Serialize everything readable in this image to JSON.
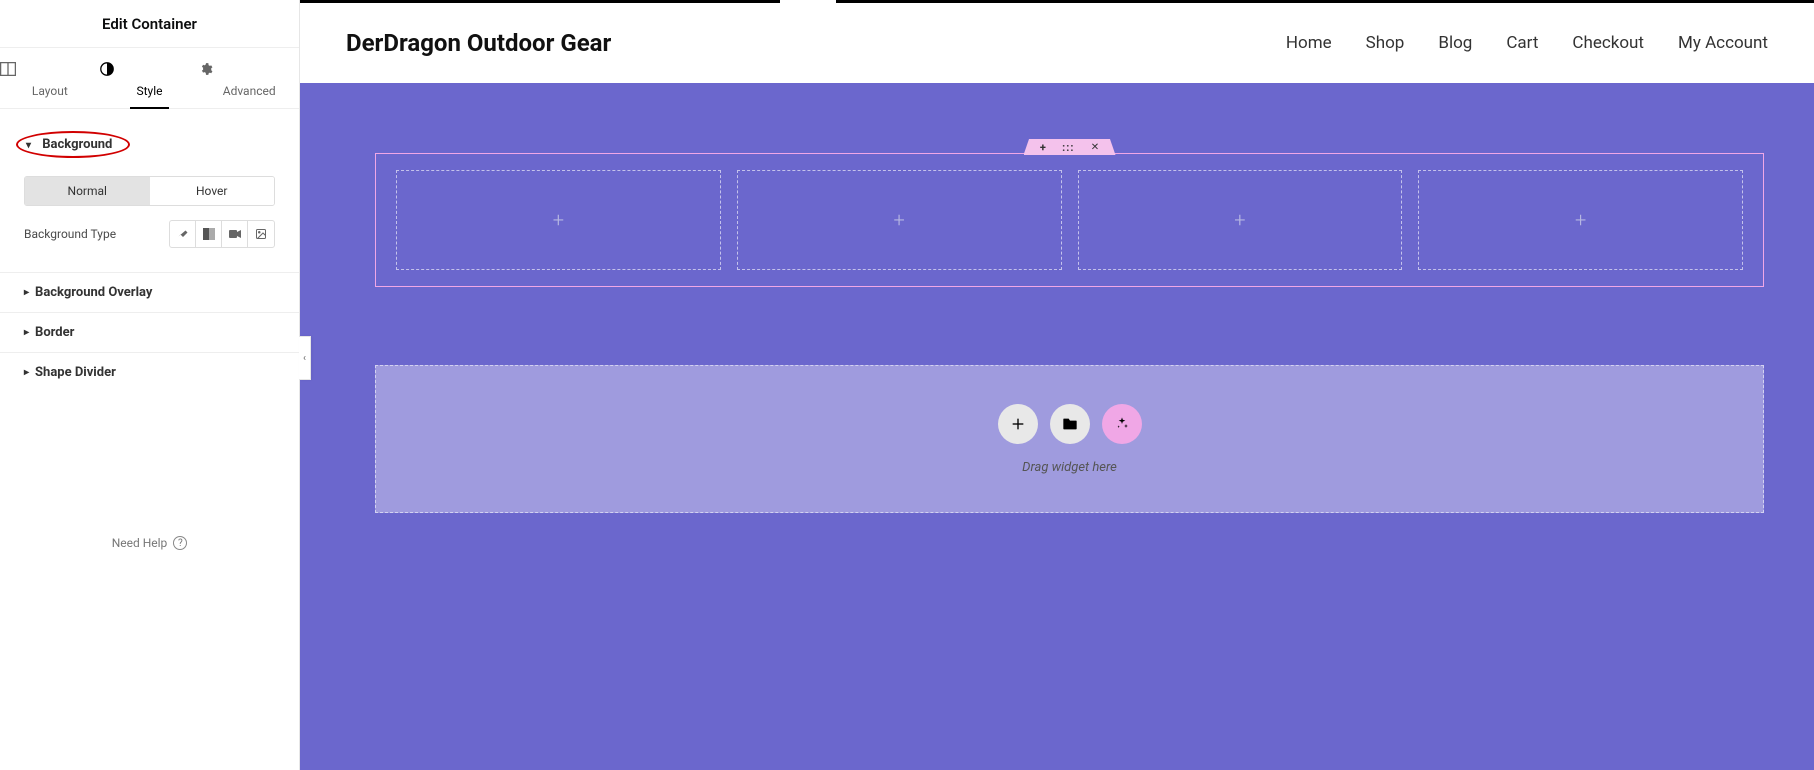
{
  "panel": {
    "title": "Edit Container",
    "tabs": [
      {
        "label": "Layout",
        "icon": "layout-icon"
      },
      {
        "label": "Style",
        "icon": "style-icon"
      },
      {
        "label": "Advanced",
        "icon": "gear-icon"
      }
    ],
    "active_tab": 1,
    "sections": {
      "background": {
        "label": "Background",
        "states": {
          "normal": "Normal",
          "hover": "Hover"
        },
        "active_state": "normal",
        "bg_type_label": "Background Type"
      },
      "overlay": {
        "label": "Background Overlay"
      },
      "border": {
        "label": "Border"
      },
      "shape_divider": {
        "label": "Shape Divider"
      }
    },
    "help": {
      "label": "Need Help"
    }
  },
  "site": {
    "title": "DerDragon Outdoor Gear",
    "nav": [
      "Home",
      "Shop",
      "Blog",
      "Cart",
      "Checkout",
      "My Account"
    ]
  },
  "editor": {
    "handle": {
      "add": "+",
      "drag": ":::",
      "close": "✕"
    },
    "col_count": 4,
    "drop_hint": "Drag widget here"
  },
  "colors": {
    "page_bg": "#6b67cd",
    "selection": "#f0a7e6",
    "handle_bg": "#f4c2ec",
    "dropzone_bg": "#9f9bde"
  }
}
